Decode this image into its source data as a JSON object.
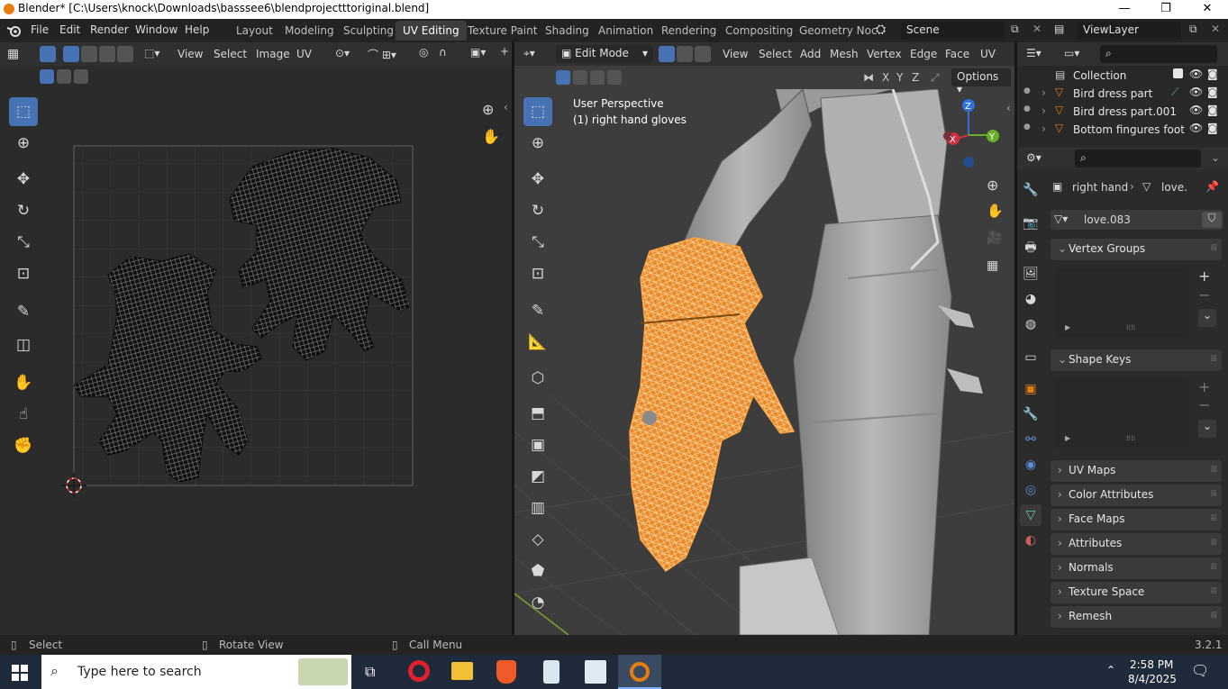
{
  "title_bar": {
    "title": "Blender* [C:\\Users\\knock\\Downloads\\basssee6\\blendprojectttoriginal.blend]",
    "minimize": "—",
    "maximize": "❐",
    "close": "✕"
  },
  "menu": {
    "items": [
      "File",
      "Edit",
      "Render",
      "Window",
      "Help"
    ],
    "workspace_tabs": [
      "Layout",
      "Modeling",
      "Sculpting",
      "UV Editing",
      "Texture Paint",
      "Shading",
      "Animation",
      "Rendering",
      "Compositing",
      "Geometry Noc"
    ],
    "active_tab": "UV Editing",
    "scene": "Scene",
    "view_layer": "ViewLayer"
  },
  "uv_editor": {
    "header": [
      "View",
      "Select",
      "Image",
      "UV"
    ],
    "tools": [
      "select-box-icon",
      "cursor-icon",
      "move-icon",
      "rotate-icon",
      "scale-icon",
      "transform-icon",
      "annotate-icon",
      "rip-icon",
      "grab-icon",
      "relax-icon",
      "pinch-icon"
    ]
  },
  "viewport": {
    "mode": "Edit Mode",
    "header": [
      "View",
      "Select",
      "Add",
      "Mesh",
      "Vertex",
      "Edge",
      "Face",
      "UV"
    ],
    "options_label": "Options",
    "axis_buttons": [
      "X",
      "Y",
      "Z"
    ],
    "overlay_title": "User Perspective",
    "overlay_object": "(1) right hand gloves",
    "gizmo": {
      "z": "Z",
      "y": "Y",
      "x": "X"
    }
  },
  "outliner": {
    "rows": [
      {
        "label": "Collection"
      },
      {
        "label": "Bird dress part"
      },
      {
        "label": "Bird dress part.001"
      },
      {
        "label": "Bottom fingures foot"
      }
    ]
  },
  "properties": {
    "breadcrumb_object": "right hand",
    "breadcrumb_data": "love.",
    "mesh_name": "love.083",
    "panels": {
      "vertex_groups": "Vertex Groups",
      "shape_keys": "Shape Keys",
      "uv_maps": "UV Maps",
      "color_attributes": "Color Attributes",
      "face_maps": "Face Maps",
      "attributes": "Attributes",
      "normals": "Normals",
      "texture_space": "Texture Space",
      "remesh": "Remesh"
    }
  },
  "status_bar": {
    "select": "Select",
    "rotate": "Rotate View",
    "call_menu": "Call Menu",
    "version": "3.2.1"
  },
  "taskbar": {
    "search_placeholder": "Type here to search",
    "time": "2:58 PM",
    "date": "8/4/2025"
  },
  "colors": {
    "accent": "#4772b3",
    "selection_orange": "#f0902a",
    "blender_orange": "#e87d0d"
  }
}
